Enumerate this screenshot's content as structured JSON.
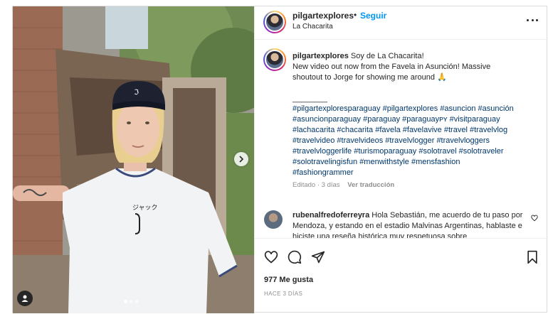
{
  "header": {
    "username": "pilgartexplores",
    "separator": "•",
    "follow_label": "Seguir",
    "location": "La Chacarita"
  },
  "caption": {
    "username": "pilgartexplores",
    "line1": "Soy de La Chacarita!",
    "line2": "New video out now from the Favela in Asunción! Massive",
    "line3": "shoutout to Jorge for showing me around 🙏",
    "divider": "________",
    "hashtags": [
      "#pilgartexploresparaguay",
      "#pilgartexplores",
      "#asuncion",
      "#asunción",
      "#asuncionparaguay",
      "#paraguay",
      "#paraguayᴘʏ",
      "#visitparaguay",
      "#lachacarita",
      "#chacarita",
      "#favela",
      "#favelavive",
      "#travel",
      "#travelvlog",
      "#travelvideo",
      "#travelvideos",
      "#travelvlogger",
      "#travelvloggers",
      "#travelvloggerlife",
      "#turismoparaguay",
      "#solotravel",
      "#solotraveler",
      "#solotravelingisfun",
      "#menwithstyle",
      "#mensfashion",
      "#fashiongrammer"
    ],
    "edited": "Editado · 3 días",
    "translate_label": "Ver traducción"
  },
  "comment": {
    "username": "rubenalfredoferreyra",
    "text": "Hola Sebastián, me acuerdo de tu paso por Mendoza, y estando en el estadio Malvinas Argentinas, hablaste e hiciste una reseña histórica muy respetuosa sobre"
  },
  "footer": {
    "likes": "977 Me gusta",
    "date": "HACE 3 DÍAS"
  },
  "carousel": {
    "total_images": 3,
    "current_index": 1
  },
  "icons": {
    "like": "heart-icon",
    "comment": "comment-icon",
    "share": "paper-plane-icon",
    "save": "bookmark-icon",
    "more": "more-options-icon",
    "next": "chevron-right-icon",
    "tag": "user-tag-icon"
  },
  "colors": {
    "link_blue": "#0095f6",
    "hashtag": "#00376b",
    "secondary_text": "#8e8e8e",
    "border": "#dbdbdb"
  }
}
